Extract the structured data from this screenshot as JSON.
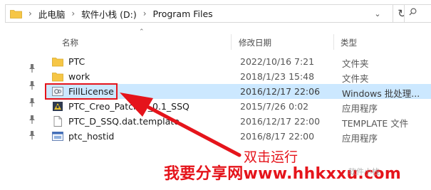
{
  "address_bar": {
    "breadcrumbs": [
      "此电脑",
      "软件小栈 (D:)",
      "Program Files"
    ]
  },
  "columns": {
    "name": "名称",
    "date": "修改日期",
    "type": "类型"
  },
  "files": [
    {
      "name": "PTC",
      "date": "2022/10/16 7:21",
      "type": "文件夹",
      "icon": "folder-icon"
    },
    {
      "name": "work",
      "date": "2018/1/23 15:48",
      "type": "文件夹",
      "icon": "folder-icon"
    },
    {
      "name": "FillLicense",
      "date": "2016/12/17 22:06",
      "type": "Windows 批处理...",
      "icon": "batch-file-icon",
      "selected": true
    },
    {
      "name": "PTC_Creo_Patcher_0.1_SSQ",
      "date": "2015/7/26 0:02",
      "type": "应用程序",
      "icon": "patcher-app-icon"
    },
    {
      "name": "PTC_D_SSQ.dat.template",
      "date": "2016/12/17 22:00",
      "type": "TEMPLATE 文件",
      "icon": "document-icon"
    },
    {
      "name": "ptc_hostid",
      "date": "2016/8/17 22:00",
      "type": "应用程序",
      "icon": "hostid-app-icon"
    }
  ],
  "annotation": {
    "instruction": "双击运行",
    "watermark": "我要分享网www.hhkxxu.com",
    "logo_text": "软件小栈",
    "color": "#e5141b"
  },
  "colors": {
    "folder": "#f6c646",
    "selection": "#cce8ff"
  }
}
